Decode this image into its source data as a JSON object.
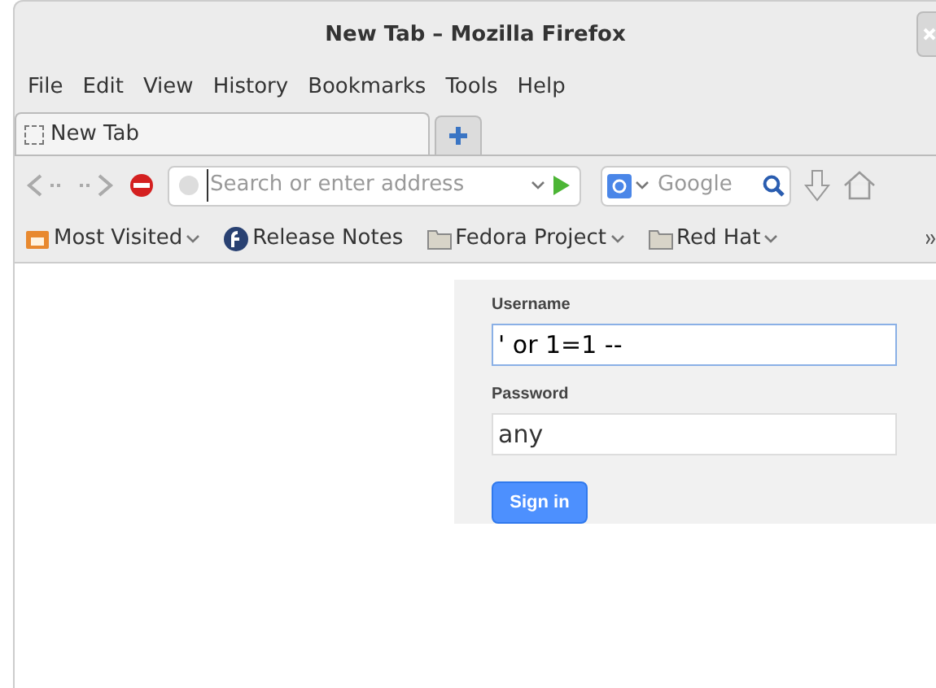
{
  "window": {
    "title": "New Tab – Mozilla Firefox"
  },
  "menu": [
    "File",
    "Edit",
    "View",
    "History",
    "Bookmarks",
    "Tools",
    "Help"
  ],
  "tabs": [
    {
      "label": "New Tab",
      "selected": true
    }
  ],
  "address_bar": {
    "placeholder": "Search or enter address"
  },
  "search_bar": {
    "placeholder": "Google"
  },
  "bookmarks": [
    {
      "label": "Most Visited",
      "kind": "feed",
      "dropdown": true
    },
    {
      "label": "Release Notes",
      "kind": "fedora",
      "dropdown": false
    },
    {
      "label": "Fedora Project",
      "kind": "folder",
      "dropdown": true
    },
    {
      "label": "Red Hat",
      "kind": "folder",
      "dropdown": true
    }
  ],
  "login": {
    "username_label": "Username",
    "username": "' or 1=1 --",
    "password_label": "Password",
    "password": "any",
    "button": "Sign in"
  }
}
